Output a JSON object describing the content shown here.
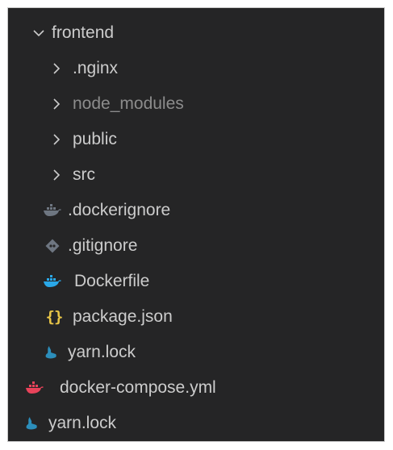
{
  "explorer": {
    "items": [
      {
        "label": "frontend",
        "type": "folder",
        "expanded": true,
        "icon": "chevron-down-icon"
      },
      {
        "label": ".nginx",
        "type": "folder",
        "expanded": false,
        "icon": "chevron-right-icon"
      },
      {
        "label": "node_modules",
        "type": "folder",
        "expanded": false,
        "icon": "chevron-right-icon",
        "dimmed": true
      },
      {
        "label": "public",
        "type": "folder",
        "expanded": false,
        "icon": "chevron-right-icon"
      },
      {
        "label": "src",
        "type": "folder",
        "expanded": false,
        "icon": "chevron-right-icon"
      },
      {
        "label": ".dockerignore",
        "type": "file",
        "icon": "docker-ignore-icon"
      },
      {
        "label": ".gitignore",
        "type": "file",
        "icon": "git-icon"
      },
      {
        "label": "Dockerfile",
        "type": "file",
        "icon": "docker-icon"
      },
      {
        "label": "package.json",
        "type": "file",
        "icon": "json-icon",
        "icon_glyph": "{}"
      },
      {
        "label": "yarn.lock",
        "type": "file",
        "icon": "yarn-icon"
      },
      {
        "label": "docker-compose.yml",
        "type": "file",
        "icon": "docker-compose-icon"
      },
      {
        "label": "yarn.lock",
        "type": "file",
        "icon": "yarn-icon"
      }
    ]
  },
  "colors": {
    "background": "#252526",
    "text": "#cccccc",
    "text_dimmed": "#8c8c8c",
    "docker_blue": "#2aa8e8",
    "docker_ignore_gray": "#6e7681",
    "git_gray": "#6e7681",
    "json_yellow": "#e8c547",
    "yarn_blue": "#2c8ebb",
    "compose_pink": "#e8435a"
  }
}
